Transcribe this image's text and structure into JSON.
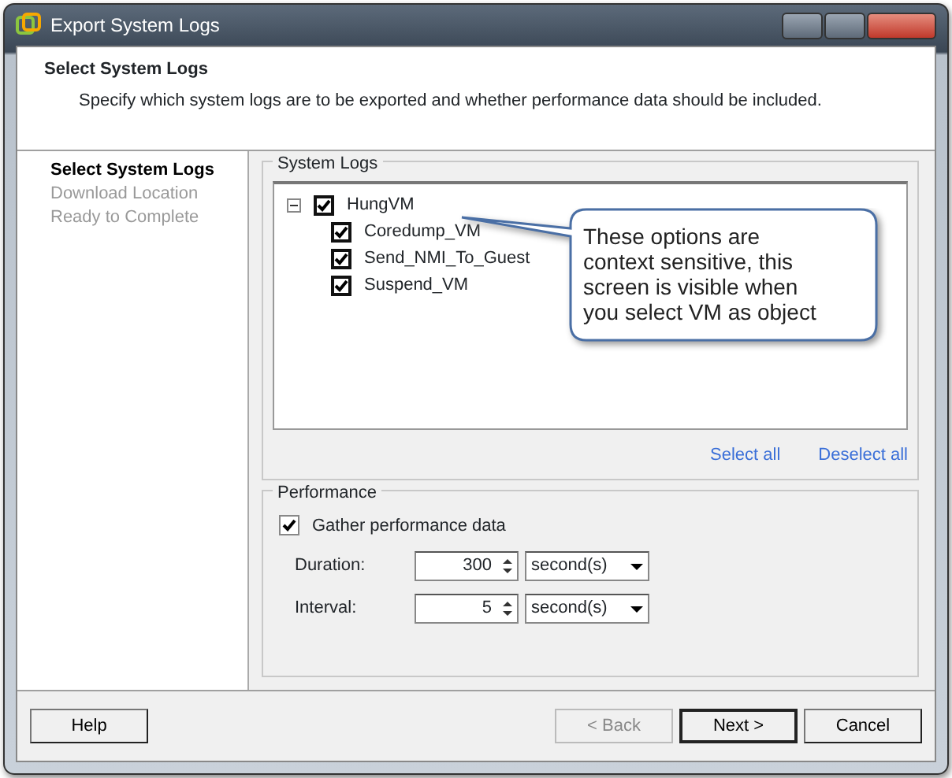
{
  "window": {
    "title": "Export System Logs"
  },
  "header": {
    "title": "Select System Logs",
    "description": "Specify which system logs are to be exported and whether performance data should be included."
  },
  "steps": [
    {
      "label": "Select System Logs",
      "selected": true
    },
    {
      "label": "Download Location",
      "selected": false
    },
    {
      "label": "Ready to Complete",
      "selected": false
    }
  ],
  "system_logs": {
    "title": "System Logs",
    "tree": [
      {
        "label": "HungVM",
        "checked": true,
        "expanded": true,
        "children": [
          {
            "label": "Coredump_VM",
            "checked": true
          },
          {
            "label": "Send_NMI_To_Guest",
            "checked": true
          },
          {
            "label": "Suspend_VM",
            "checked": true
          }
        ]
      }
    ],
    "links": [
      "Select all",
      "Deselect all"
    ]
  },
  "callout": {
    "text": "These options are context sensitive, this screen is visible when you select VM as  object"
  },
  "performance": {
    "title": "Performance",
    "gather": {
      "label": "Gather performance data",
      "checked": true
    },
    "fields": [
      {
        "label": "Duration:",
        "value": "300",
        "unit": "second(s)"
      },
      {
        "label": "Interval:",
        "value": "5",
        "unit": "second(s)"
      }
    ]
  },
  "buttons": [
    {
      "label": "Help",
      "disabled": false,
      "default": false
    },
    {
      "label": "< Back",
      "disabled": true,
      "default": false
    },
    {
      "label": "Next >",
      "disabled": false,
      "default": true
    },
    {
      "label": "Cancel",
      "disabled": false,
      "default": false
    }
  ]
}
